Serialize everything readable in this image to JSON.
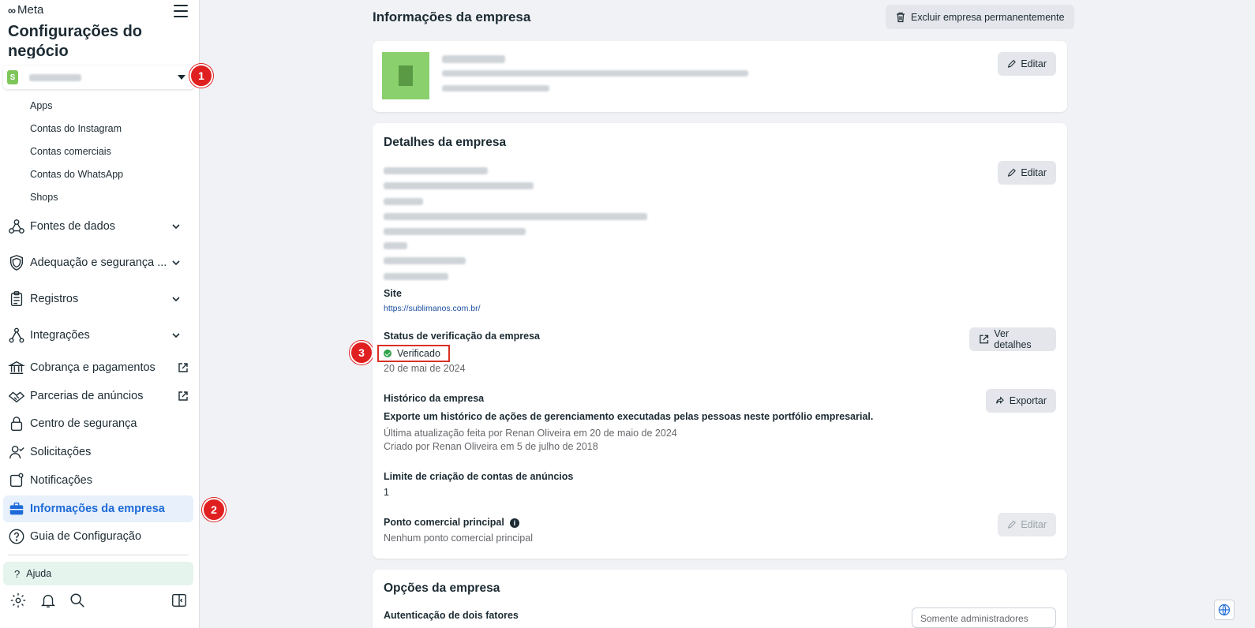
{
  "sidebar": {
    "brand": "Meta",
    "title": "Configurações do negócio",
    "subitems": [
      "Apps",
      "Contas do Instagram",
      "Contas comerciais",
      "Contas do WhatsApp",
      "Shops"
    ],
    "nav": [
      {
        "label": "Fontes de dados",
        "icon": "data-sources-icon"
      },
      {
        "label": "Adequação e segurança ...",
        "icon": "shield-icon"
      },
      {
        "label": "Registros",
        "icon": "clipboard-icon"
      },
      {
        "label": "Integrações",
        "icon": "integrations-icon"
      },
      {
        "label": "Cobrança e pagamentos",
        "icon": "bank-icon"
      },
      {
        "label": "Parcerias de anúncios",
        "icon": "handshake-icon"
      },
      {
        "label": "Centro de segurança",
        "icon": "lock-icon"
      },
      {
        "label": "Solicitações",
        "icon": "person-check-icon"
      },
      {
        "label": "Notificações",
        "icon": "notification-icon"
      },
      {
        "label": "Informações da empresa",
        "icon": "briefcase-icon"
      },
      {
        "label": "Guia de Configuração",
        "icon": "question-circle-icon"
      }
    ],
    "help": "Ajuda"
  },
  "badges": {
    "one": "1",
    "two": "2",
    "three": "3"
  },
  "main": {
    "header": "Informações da empresa",
    "delete_button": "Excluir empresa permanentemente",
    "edit_label": "Editar",
    "details": {
      "title": "Detalhes da empresa",
      "site_label": "Site",
      "site_value": "https://sublimanos.com.br/",
      "status_label": "Status de verificação da empresa",
      "status_value": "Verificado",
      "status_date": "20 de mai de 2024",
      "view_details": "Ver detalhes",
      "history_label": "Histórico da empresa",
      "history_desc": "Exporte um histórico de ações de gerenciamento executadas pelas pessoas neste portfólio empresarial.",
      "history_updated": "Última atualização feita por Renan Oliveira em 20 de maio de 2024",
      "history_created": "Criado por Renan Oliveira em 5 de julho de 2018",
      "export_label": "Exportar",
      "limit_label": "Limite de criação de contas de anúncios",
      "limit_value": "1",
      "point_label": "Ponto comercial principal",
      "point_value": "Nenhum ponto comercial principal"
    },
    "options": {
      "title": "Opções da empresa",
      "twofa_label": "Autenticação de dois fatores",
      "twofa_value": "Somente administradores"
    }
  },
  "colors": {
    "accent": "#1d6ad8",
    "badge": "#e02020",
    "verified": "#31a24c"
  }
}
